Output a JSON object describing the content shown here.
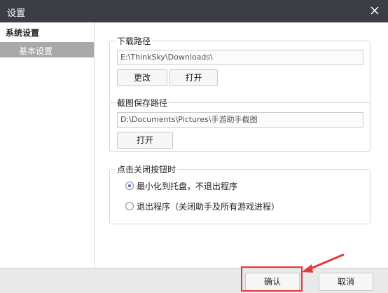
{
  "window": {
    "title": "设置",
    "close_icon": "close-icon"
  },
  "sidebar": {
    "group": "系统设置",
    "items": [
      {
        "label": "基本设置",
        "selected": true
      }
    ]
  },
  "sections": {
    "download": {
      "label": "下载路径",
      "path": "E:\\ThinkSky\\Downloads\\",
      "change_button": "更改",
      "open_button": "打开"
    },
    "screenshot": {
      "label": "截图保存路径",
      "path": "D:\\Documents\\Pictures\\手游助手截图",
      "open_button": "打开"
    },
    "close_behavior": {
      "label": "点击关闭按钮时",
      "options": [
        {
          "label": "最小化到托盘，不退出程序",
          "checked": true
        },
        {
          "label": "退出程序（关闭助手及所有游戏进程）",
          "checked": false
        }
      ]
    }
  },
  "footer": {
    "confirm": "确认",
    "cancel": "取消"
  },
  "colors": {
    "titlebar": "#3b3e45",
    "sidebar_selected": "#a9a9a9",
    "annotation": "#e23b3b",
    "radio_accent": "#3d6bd8"
  }
}
